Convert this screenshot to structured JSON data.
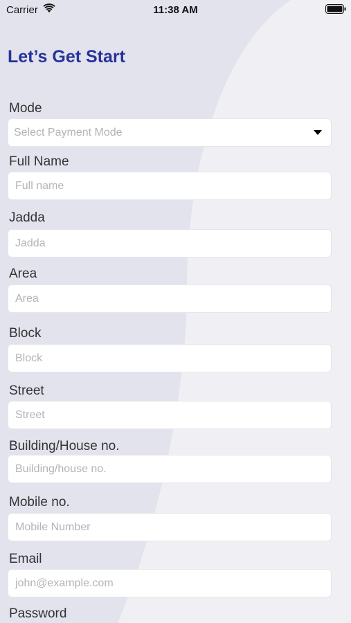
{
  "status_bar": {
    "carrier": "Carrier",
    "time": "11:38 AM"
  },
  "header": {
    "title": "Let’s Get Start"
  },
  "form": {
    "mode": {
      "label": "Mode",
      "placeholder": "Select Payment Mode"
    },
    "fullname": {
      "label": "Full Name",
      "placeholder": "Full name"
    },
    "jadda": {
      "label": "Jadda",
      "placeholder": "Jadda"
    },
    "area": {
      "label": "Area",
      "placeholder": "Area"
    },
    "block": {
      "label": "Block",
      "placeholder": "Block"
    },
    "street": {
      "label": "Street",
      "placeholder": "Street"
    },
    "building": {
      "label": "Building/House no.",
      "placeholder": "Building/house no."
    },
    "mobile": {
      "label": "Mobile no.",
      "placeholder": "Mobile Number"
    },
    "email": {
      "label": "Email",
      "placeholder": "john@example.com"
    },
    "password": {
      "label": "Password"
    }
  },
  "icons": {
    "wifi": "wifi-icon",
    "battery": "battery-icon",
    "dropdown": "chevron-down-icon"
  },
  "colors": {
    "title": "#27339a",
    "background": "#efeff4",
    "background_shape": "#e2e2ec"
  }
}
